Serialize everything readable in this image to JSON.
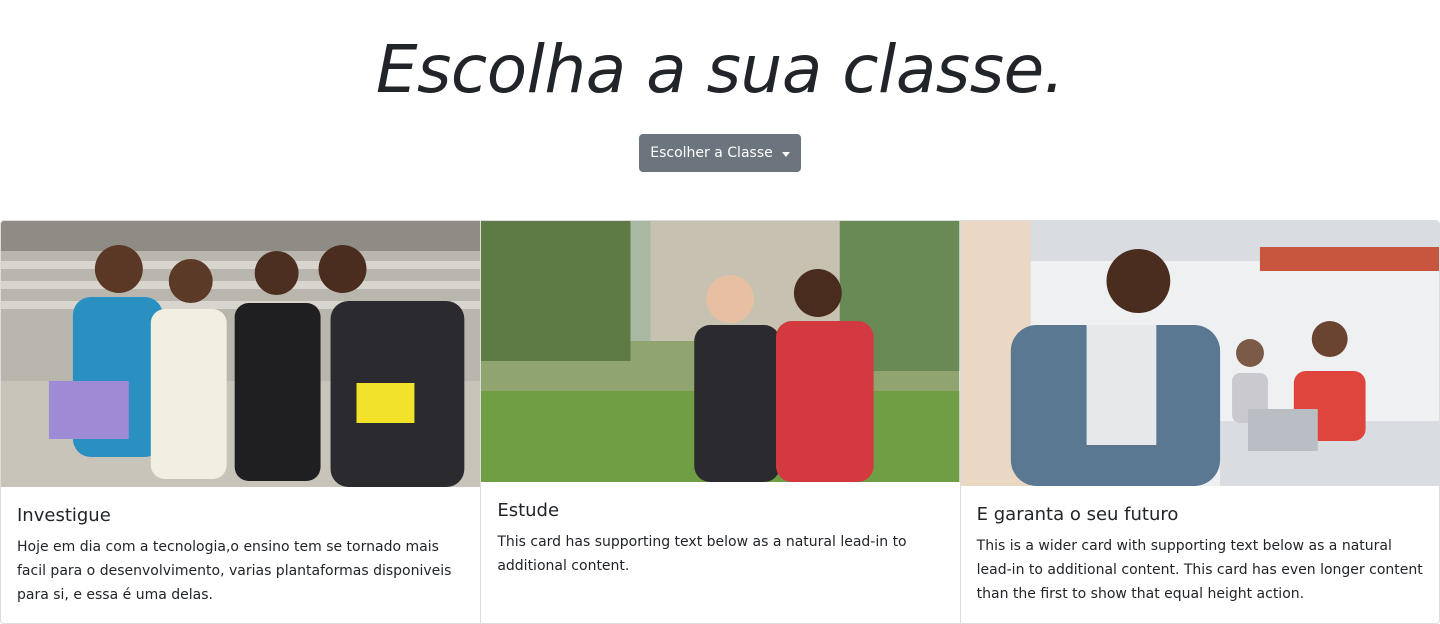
{
  "header": {
    "title": "Escolha a sua classe."
  },
  "dropdown": {
    "label": "Escolher a Classe"
  },
  "cards": [
    {
      "title": "Investigue",
      "text": "Hoje em dia com a tecnologia,o ensino tem se tornado mais facil para o desenvolvimento, varias plantaformas disponiveis para si, e essa é uma delas."
    },
    {
      "title": "Estude",
      "text": "This card has supporting text below as a natural lead-in to additional content."
    },
    {
      "title": "E garanta o seu futuro",
      "text": "This is a wider card with supporting text below as a natural lead-in to additional content. This card has even longer content than the first to show that equal height action."
    }
  ],
  "colors": {
    "button_bg": "#6c757d",
    "text": "#212529",
    "border": "#dcdcdc"
  }
}
